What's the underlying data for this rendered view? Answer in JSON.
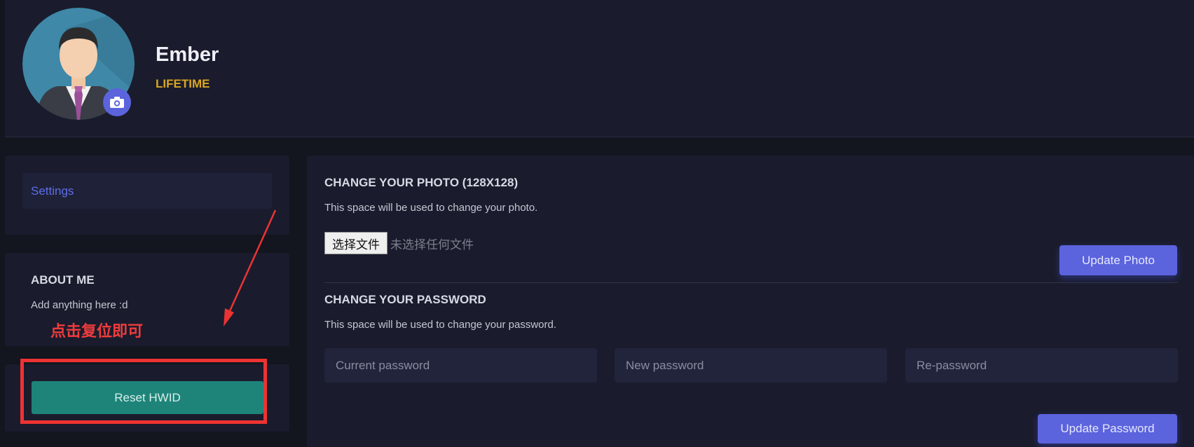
{
  "profile": {
    "username": "Ember",
    "plan": "LIFETIME",
    "avatar_icon": "user-avatar-icon",
    "camera_icon": "camera-icon"
  },
  "sidebar": {
    "nav_items": [
      {
        "label": "Settings",
        "active": true
      }
    ],
    "about_title": "ABOUT ME",
    "about_text": "Add anything here :d",
    "reset_button": "Reset HWID"
  },
  "annotation": {
    "note": "点击复位即可"
  },
  "photo_section": {
    "title": "CHANGE YOUR PHOTO (128X128)",
    "description": "This space will be used to change your photo.",
    "file_button": "选择文件",
    "file_status": "未选择任何文件",
    "submit": "Update Photo"
  },
  "password_section": {
    "title": "CHANGE YOUR PASSWORD",
    "description": "This space will be used to change your password.",
    "current_placeholder": "Current password",
    "new_placeholder": "New password",
    "repeat_placeholder": "Re-password",
    "submit": "Update Password"
  },
  "colors": {
    "background": "#13151f",
    "card": "#1a1c2d",
    "accent": "#5b63dd",
    "plan_gold": "#d9a521",
    "reset_teal": "#1e847a",
    "annotation_red": "#ec3333"
  }
}
